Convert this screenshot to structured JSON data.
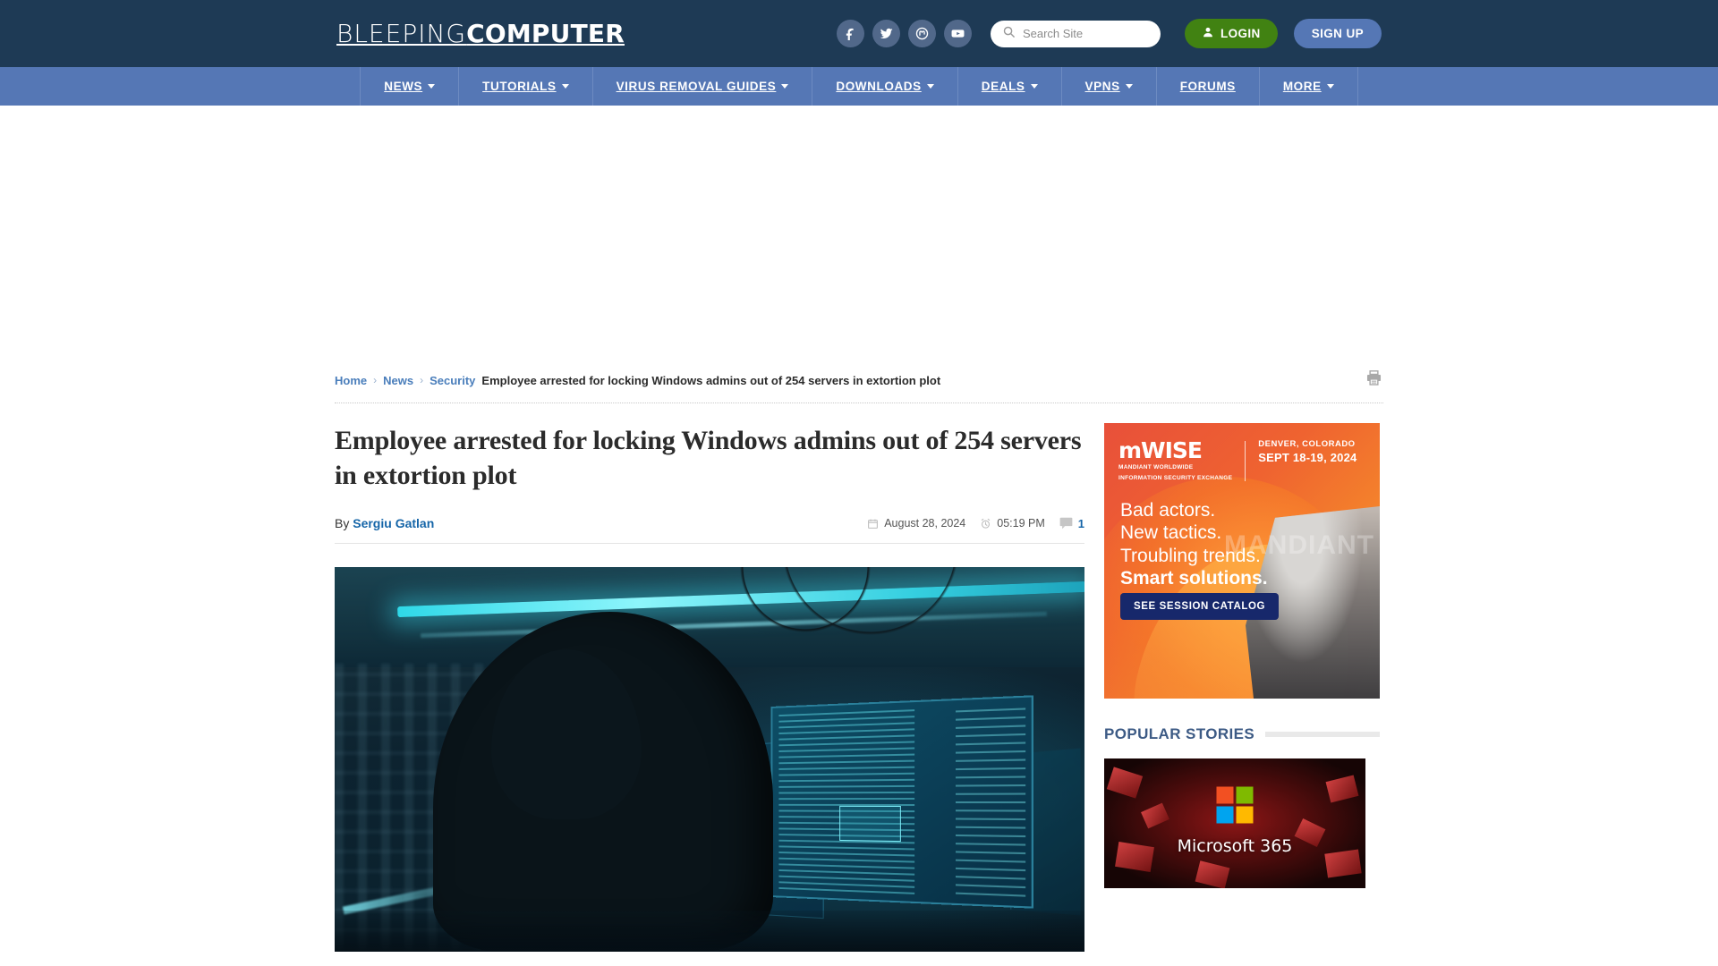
{
  "site": {
    "logo_light": "BLEEPING",
    "logo_bold": "COMPUTER"
  },
  "header": {
    "social": [
      {
        "name": "facebook-icon",
        "label": "Facebook"
      },
      {
        "name": "twitter-icon",
        "label": "Twitter"
      },
      {
        "name": "mastodon-icon",
        "label": "Mastodon"
      },
      {
        "name": "youtube-icon",
        "label": "YouTube"
      }
    ],
    "search": {
      "placeholder": "Search Site",
      "value": ""
    },
    "login_label": "LOGIN",
    "signup_label": "SIGN UP",
    "login_color": "#418212",
    "signup_color": "#5577b5",
    "bg_color": "#1e3a55"
  },
  "nav": {
    "bg_color": "#5577b5",
    "items": [
      {
        "label": "NEWS",
        "has_dropdown": true
      },
      {
        "label": "TUTORIALS",
        "has_dropdown": true
      },
      {
        "label": "VIRUS REMOVAL GUIDES",
        "has_dropdown": true
      },
      {
        "label": "DOWNLOADS",
        "has_dropdown": true
      },
      {
        "label": "DEALS",
        "has_dropdown": true
      },
      {
        "label": "VPNS",
        "has_dropdown": true
      },
      {
        "label": "FORUMS",
        "has_dropdown": false
      },
      {
        "label": "MORE",
        "has_dropdown": true
      }
    ]
  },
  "breadcrumb": {
    "home": "Home",
    "news": "News",
    "security": "Security",
    "current": "Employee arrested for locking Windows admins out of 254 servers in extortion plot",
    "separator": "›"
  },
  "article": {
    "headline": "Employee arrested for locking Windows admins out of 254 servers in extortion plot",
    "by_label": "By",
    "author": "Sergiu Gatlan",
    "date": "August 28, 2024",
    "time": "05:19 PM",
    "comment_count": "1",
    "hero_alt": "Hooded hacker at computer monitors in a dark server room"
  },
  "sidebar": {
    "ad": {
      "brand": "mWISE",
      "brand_sub_line1": "MANDIANT WORLDWIDE",
      "brand_sub_line2": "INFORMATION SECURITY EXCHANGE",
      "location": "DENVER, COLORADO",
      "dates": "SEPT 18-19, 2024",
      "lines": [
        "Bad actors.",
        "New tactics.",
        "Troubling trends."
      ],
      "line_bold": "Smart solutions.",
      "cta": "SEE SESSION CATALOG",
      "ghost_text": "MANDIANT",
      "cta_color": "#17286b"
    },
    "popular": {
      "title": "POPULAR STORIES",
      "story_thumb_label": "Microsoft 365"
    }
  }
}
